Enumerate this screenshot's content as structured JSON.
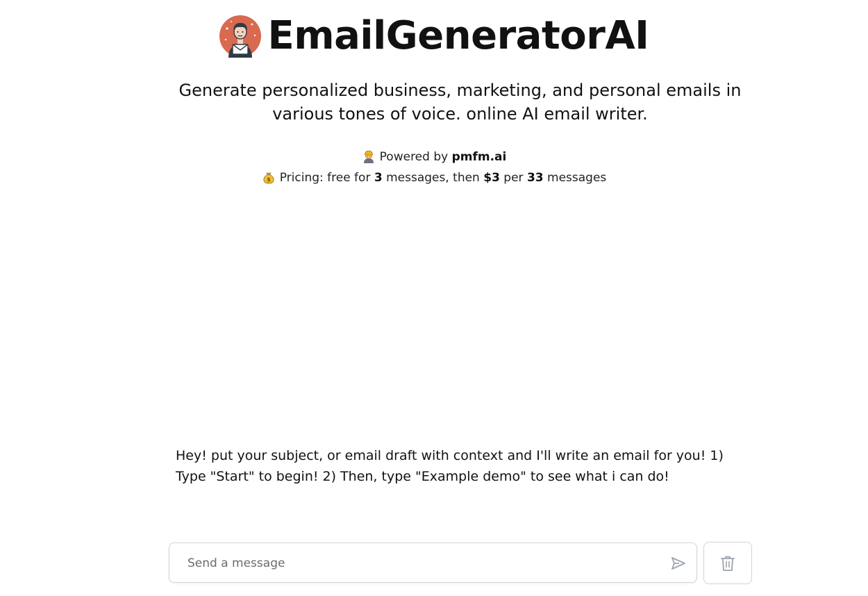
{
  "header": {
    "title": "EmailGeneratorAI",
    "logo_icon": "email-man-logo-icon"
  },
  "subtitle": "Generate personalized business, marketing, and personal emails in various tones of voice. online AI email writer.",
  "powered": {
    "icon": "worker-icon",
    "prefix": "Powered by ",
    "brand": "pmfm.ai"
  },
  "pricing": {
    "icon": "money-bag-icon",
    "prefix": "Pricing: free for ",
    "free_count": "3",
    "middle": " messages, then ",
    "price": "$3",
    "per": " per ",
    "bundle_count": "33",
    "suffix": " messages"
  },
  "chat": {
    "messages": [
      "Hey! put your subject, or email draft with context and I'll write an email for you! 1) Type \"Start\" to begin! 2) Then, type \"Example demo\" to see what i can do!"
    ]
  },
  "composer": {
    "placeholder": "Send a message",
    "value": "",
    "send_icon": "send-icon",
    "clear_icon": "trash-icon"
  },
  "colors": {
    "logo_bg": "#d9694f",
    "border": "#d4d4d8",
    "icon_gray": "#9ca3af",
    "text": "#111111"
  }
}
